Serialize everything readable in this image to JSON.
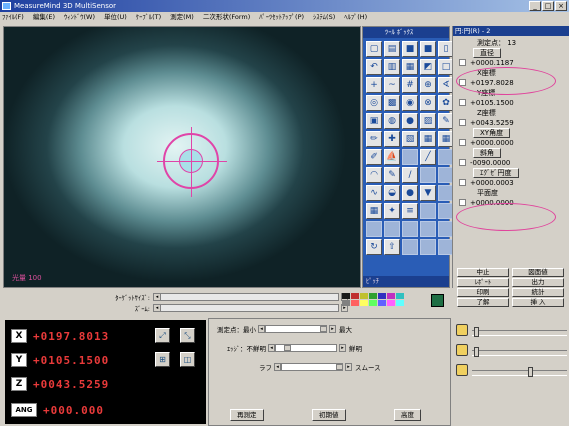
{
  "window": {
    "title": "MeasureMind 3D MultiSensor",
    "controls": [
      "_",
      "□",
      "×"
    ]
  },
  "menu": [
    "ﾌｧｲﾙ(F)",
    "編集(E)",
    "ｳｨﾝﾄﾞｳ(W)",
    "単位(U)",
    "ｹｰﾌﾞﾙ(T)",
    "測定(M)",
    "二次形状(Form)",
    "ﾊﾟｰﾂｾｯﾄｱｯﾌﾟ(P)",
    "ｼｽﾃﾑ(S)",
    "ﾍﾙﾌﾟ(H)"
  ],
  "camera": {
    "label": "光量  100"
  },
  "toolbox": {
    "title": "ﾂｰﾙ ﾎﾞｯｸｽ",
    "footer": "ﾋﾟｯﾁ",
    "tools": [
      "new-doc-icon",
      "open-folder-icon",
      "save-icon",
      "save-as-icon",
      "copy-icon",
      "undo-icon",
      "graph-icon",
      "graph2-icon",
      "tag-icon",
      "square-icon",
      "crosshair-icon",
      "wave-icon",
      "grid-icon",
      "target-icon",
      "angle-icon",
      "circle-grid-icon",
      "dots-icon",
      "circle-icon",
      "lock-icon",
      "flower-icon",
      "box-icon",
      "circle-dot-icon",
      "sphere-icon",
      "pattern-icon",
      "edit-icon",
      "pencil-icon",
      "plus-icon",
      "square2-icon",
      "image-icon",
      "image2-icon",
      "pen-icon",
      "boat-icon",
      "blank",
      "diagonal-icon",
      "blank",
      "arc-icon",
      "pencil2-icon",
      "slash-icon",
      "blank",
      "blank",
      "curve-icon",
      "blob-icon",
      "ball-icon",
      "cone-icon",
      "blank",
      "grid2-icon",
      "star-icon",
      "lines-icon",
      "blank",
      "blank",
      "blank",
      "blank",
      "blank",
      "blank",
      "blank",
      "refresh-icon",
      "pointer-icon",
      "blank",
      "blank",
      "blank"
    ],
    "glyphs": [
      "▢",
      "▤",
      "■",
      "■",
      "▯",
      "↶",
      "▥",
      "▦",
      "◩",
      "□",
      "+",
      "~",
      "#",
      "⊕",
      "∢",
      "◎",
      "▩",
      "◉",
      "⊗",
      "✿",
      "▣",
      "◍",
      "●",
      "▨",
      "✎",
      "✏",
      "✚",
      "▧",
      "▦",
      "▦",
      "✐",
      "⛵",
      " ",
      "╱",
      " ",
      "◠",
      "✎",
      "∕",
      " ",
      " ",
      "∿",
      "◒",
      "●",
      "▼",
      " ",
      "▦",
      "✦",
      "≡",
      " ",
      " ",
      " ",
      " ",
      " ",
      " ",
      " ",
      "↻",
      "⇧",
      " ",
      " ",
      " "
    ]
  },
  "results": {
    "title": "円:円(R) - 2",
    "count_label": "測定点：  13",
    "rows": [
      {
        "type": "btn",
        "text": "直径"
      },
      {
        "type": "val",
        "text": "+0000.1187"
      },
      {
        "type": "label",
        "text": "X座標"
      },
      {
        "type": "val",
        "text": "+0197.8028"
      },
      {
        "type": "label",
        "text": "Y座標"
      },
      {
        "type": "val",
        "text": "+0105.1500"
      },
      {
        "type": "label",
        "text": "Z座標"
      },
      {
        "type": "val",
        "text": "+0043.5259"
      },
      {
        "type": "btn",
        "text": "XY角度"
      },
      {
        "type": "val",
        "text": "+0000.0000"
      },
      {
        "type": "btn",
        "text": "斜角"
      },
      {
        "type": "val",
        "text": "-0090.0000"
      },
      {
        "type": "btn",
        "text": "ｴｸﾞｾﾞ円度"
      },
      {
        "type": "val",
        "text": "+0000.0003"
      },
      {
        "type": "label",
        "text": "平面度"
      },
      {
        "type": "val",
        "text": "+0000.0000"
      }
    ],
    "buttons": [
      "中止",
      "図面値",
      "ﾚﾎﾟｰﾄ",
      "出力",
      "印刷",
      "統計",
      "了解",
      "挿 入"
    ]
  },
  "strip": {
    "target_size_label": "ﾀｰｹﾞｯﾄｻｲｽﾞ:",
    "zoom_label": "ｽﾞｰﾑ:"
  },
  "palette": [
    "#1a1a1a",
    "#c03030",
    "#c0c030",
    "#30a030",
    "#3030c0",
    "#c030c0",
    "#30c0c0",
    "#808080",
    "#ff6060",
    "#ffff60",
    "#60ff60",
    "#6060ff",
    "#ff60ff",
    "#60ffff"
  ],
  "dro": {
    "x": {
      "axis": "X",
      "value": "+0197.8013"
    },
    "y": {
      "axis": "Y",
      "value": "+0105.1500"
    },
    "z": {
      "axis": "Z",
      "value": "+0043.5259"
    },
    "ang": {
      "axis": "ANG",
      "value": "+000.000"
    }
  },
  "edge": {
    "points_label": "測定点：最小",
    "points_max": "最大",
    "edge_label": "ｴｯｼﾞ：不鮮明",
    "edge_max": "鮮明",
    "rough_label": "ラフ",
    "rough_max": "スムース",
    "btn_remeasure": "再測定",
    "btn_reset": "初期値",
    "btn_advanced": "高度"
  }
}
